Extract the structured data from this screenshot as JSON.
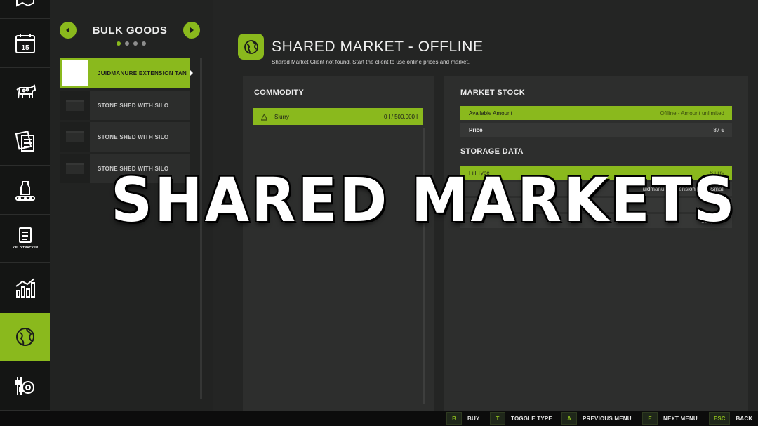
{
  "sidebar": {
    "icons": [
      {
        "name": "map-icon"
      },
      {
        "name": "calendar-icon",
        "text": "15"
      },
      {
        "name": "animals-icon"
      },
      {
        "name": "contracts-icon"
      },
      {
        "name": "production-icon"
      },
      {
        "name": "yield-tracker-icon",
        "text": "YIELD TRACKER"
      },
      {
        "name": "statistics-icon"
      },
      {
        "name": "shared-market-icon"
      },
      {
        "name": "settings-icon"
      }
    ],
    "active_index": 7
  },
  "category": {
    "title": "BULK GOODS",
    "page_dots": 4,
    "active_dot": 0,
    "items": [
      {
        "label": "LIQUIDMANURE EXTENSION TANK SMALL",
        "display": "JUIDMANURE EXTENSION TAN",
        "selected": true
      },
      {
        "label": "STONE SHED WITH SILO",
        "selected": false
      },
      {
        "label": "STONE SHED WITH SILO",
        "selected": false
      },
      {
        "label": "STONE SHED WITH SILO",
        "selected": false
      }
    ]
  },
  "header": {
    "title": "SHARED MARKET - OFFLINE",
    "subtitle": "Shared Market Client not found. Start the client to use online prices and market."
  },
  "commodity": {
    "title": "COMMODITY",
    "rows": [
      {
        "name": "Slurry",
        "amount": "0 l / 500,000 l"
      }
    ]
  },
  "market_stock": {
    "title": "MARKET STOCK",
    "available_label": "Available Amount",
    "available_value": "Offline - Amount unlimited",
    "price_label": "Price",
    "price_value": "87 €"
  },
  "storage_data": {
    "title": "STORAGE DATA",
    "fill_type_label": "Fill Type",
    "fill_type_value": "Slurry",
    "storage_value": "Liquidmanure Extension Tank Small",
    "storage_display": "uidmanure Extension Tank Small",
    "fill_level_value": "0 l",
    "capacity_value": "500,000 l"
  },
  "overlay": {
    "title": "SHARED MARKETS"
  },
  "footer": {
    "buttons": [
      {
        "key": "B",
        "label": "BUY"
      },
      {
        "key": "T",
        "label": "TOGGLE TYPE"
      },
      {
        "key": "A",
        "label": "PREVIOUS MENU"
      },
      {
        "key": "E",
        "label": "NEXT MENU"
      },
      {
        "key": "ESC",
        "label": "BACK"
      }
    ]
  },
  "colors": {
    "accent": "#8ab91d",
    "background": "#1b1c1b",
    "panel": "#2d2e2d"
  }
}
